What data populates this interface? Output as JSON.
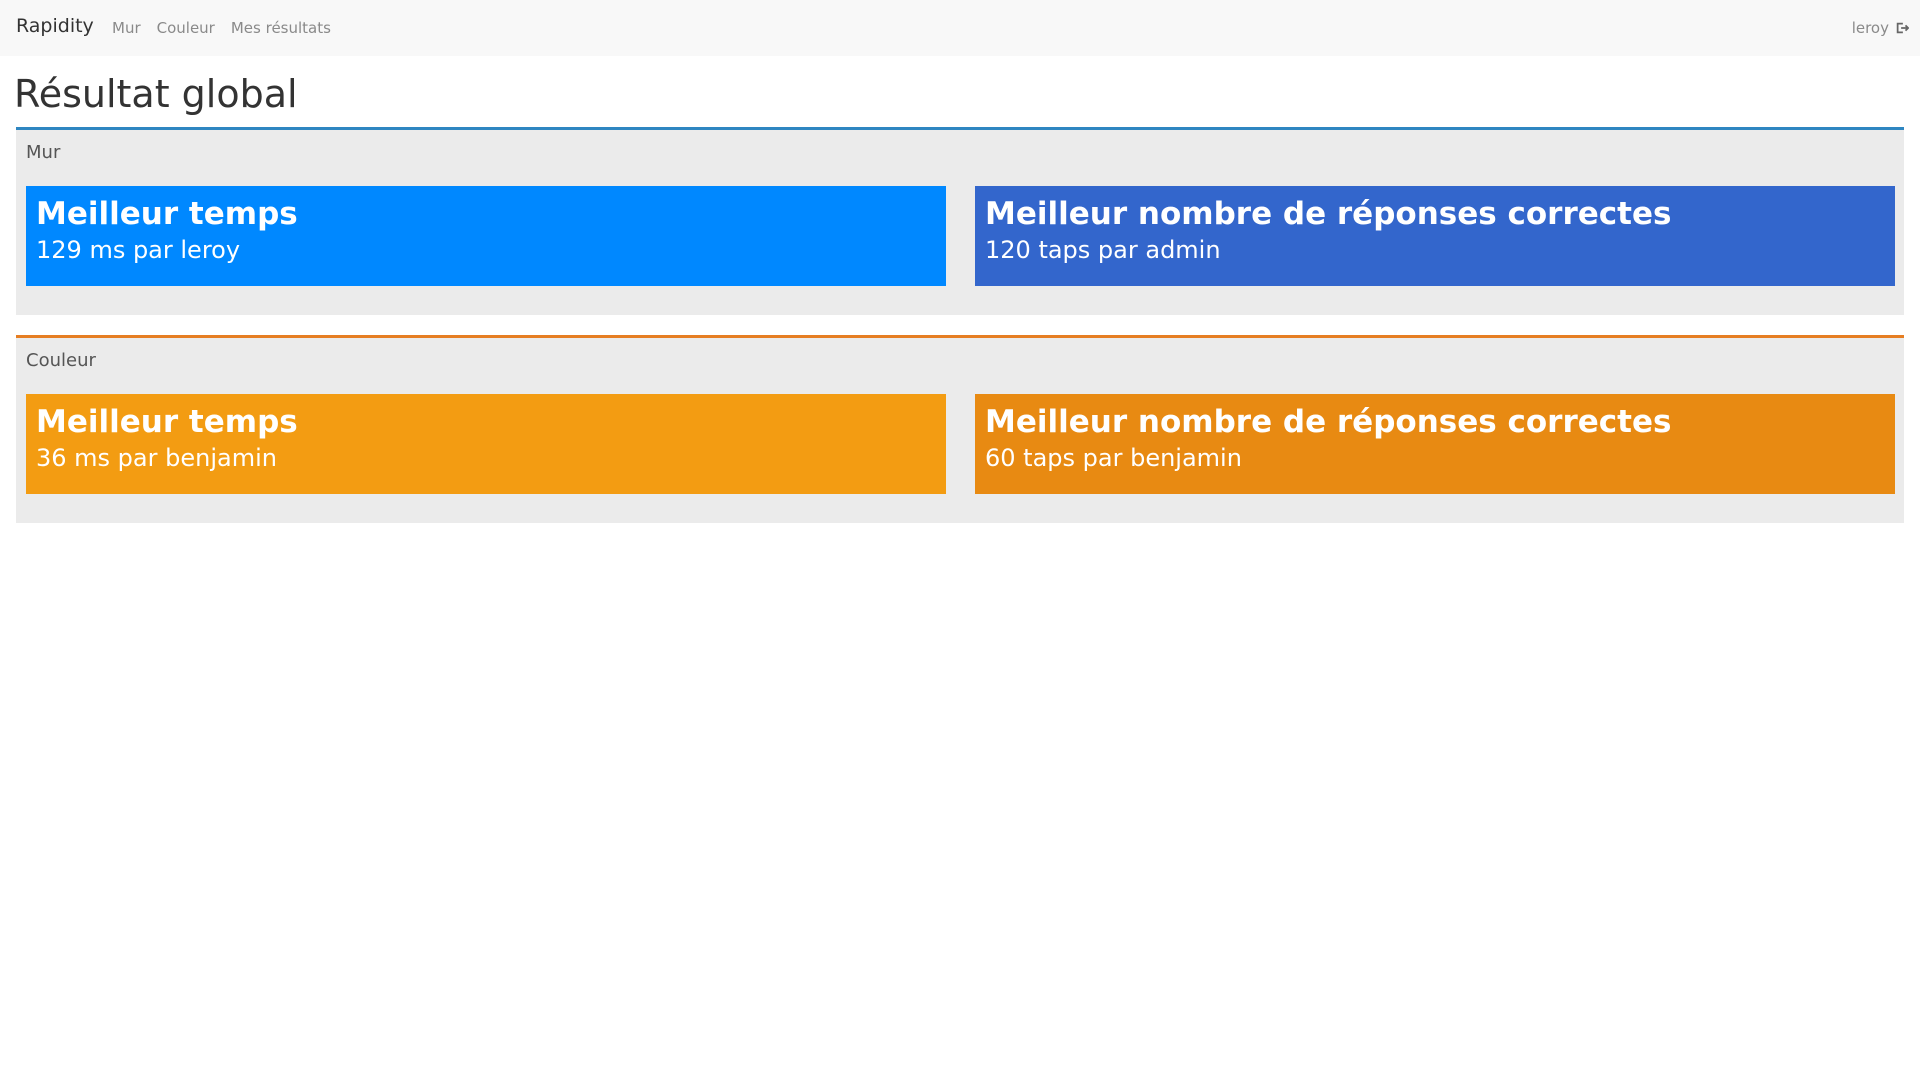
{
  "navbar": {
    "brand": "Rapidity",
    "links": [
      "Mur",
      "Couleur",
      "Mes résultats"
    ],
    "user": "leroy",
    "logout_icon": "logout-icon"
  },
  "page": {
    "title": "Résultat global"
  },
  "sections": [
    {
      "label": "Mur",
      "accent_color": "#2e86c1",
      "cards": [
        {
          "title": "Meilleur temps",
          "value": "129 ms par leroy",
          "color": "#0088ff"
        },
        {
          "title": "Meilleur nombre de réponses correctes",
          "value": "120 taps par admin",
          "color": "#3366cc"
        }
      ]
    },
    {
      "label": "Couleur",
      "accent_color": "#e67e22",
      "cards": [
        {
          "title": "Meilleur temps",
          "value": "36 ms par benjamin",
          "color": "#f39c12"
        },
        {
          "title": "Meilleur nombre de réponses correctes",
          "value": "60 taps par benjamin",
          "color": "#e88a12"
        }
      ]
    }
  ]
}
